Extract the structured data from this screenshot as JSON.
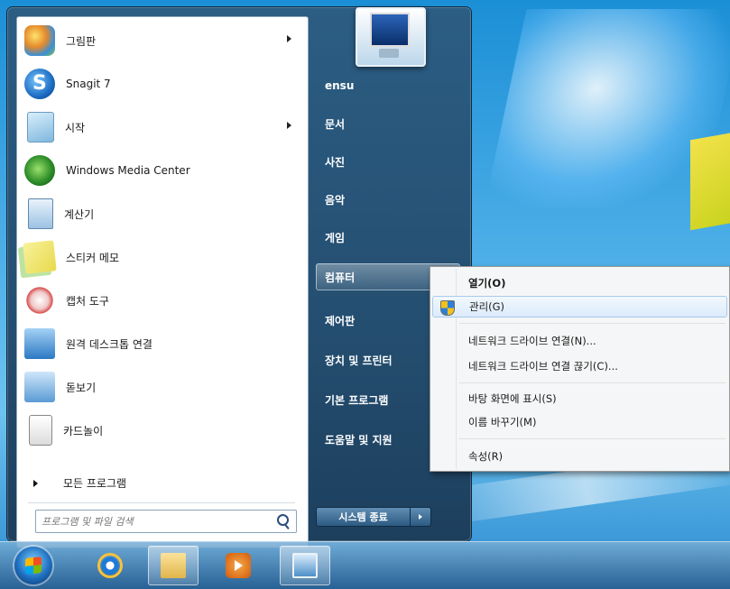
{
  "start_menu": {
    "programs": [
      {
        "label": "그림판",
        "icon": "paint-icon",
        "has_submenu": true
      },
      {
        "label": "Snagit 7",
        "icon": "snagit-icon",
        "has_submenu": false
      },
      {
        "label": "시작",
        "icon": "sync-icon",
        "has_submenu": true
      },
      {
        "label": "Windows Media Center",
        "icon": "media-center-icon",
        "has_submenu": false
      },
      {
        "label": "계산기",
        "icon": "calculator-icon",
        "has_submenu": false
      },
      {
        "label": "스티커 메모",
        "icon": "sticky-notes-icon",
        "has_submenu": false
      },
      {
        "label": "캡처 도구",
        "icon": "snipping-tool-icon",
        "has_submenu": false
      },
      {
        "label": "원격 데스크톱 연결",
        "icon": "remote-desktop-icon",
        "has_submenu": false
      },
      {
        "label": "돋보기",
        "icon": "magnifier-icon",
        "has_submenu": false
      },
      {
        "label": "카드놀이",
        "icon": "solitaire-icon",
        "has_submenu": false
      }
    ],
    "all_programs": "모든 프로그램",
    "search_placeholder": "프로그램 및 파일 검색",
    "right_items": [
      "ensu",
      "문서",
      "사진",
      "음악",
      "게임",
      "컴퓨터",
      "제어판",
      "장치 및 프린터",
      "기본 프로그램",
      "도움말 및 지원"
    ],
    "shutdown": "시스템 종료"
  },
  "context_menu": {
    "open": "열기(O)",
    "manage": "관리(G)",
    "map_drive": "네트워크 드라이브 연결(N)...",
    "disconnect_drive": "네트워크 드라이브 연결 끊기(C)...",
    "show_desktop": "바탕 화면에 표시(S)",
    "rename": "이름 바꾸기(M)",
    "properties": "속성(R)"
  },
  "taskbar": {
    "buttons": [
      "internet-explorer-icon",
      "windows-explorer-icon",
      "media-player-icon",
      "remote-desktop-icon"
    ]
  },
  "colors": {
    "menu_right": "#2c5d83",
    "highlight": "#dcebfb",
    "desktop": "#1b8fd6"
  }
}
